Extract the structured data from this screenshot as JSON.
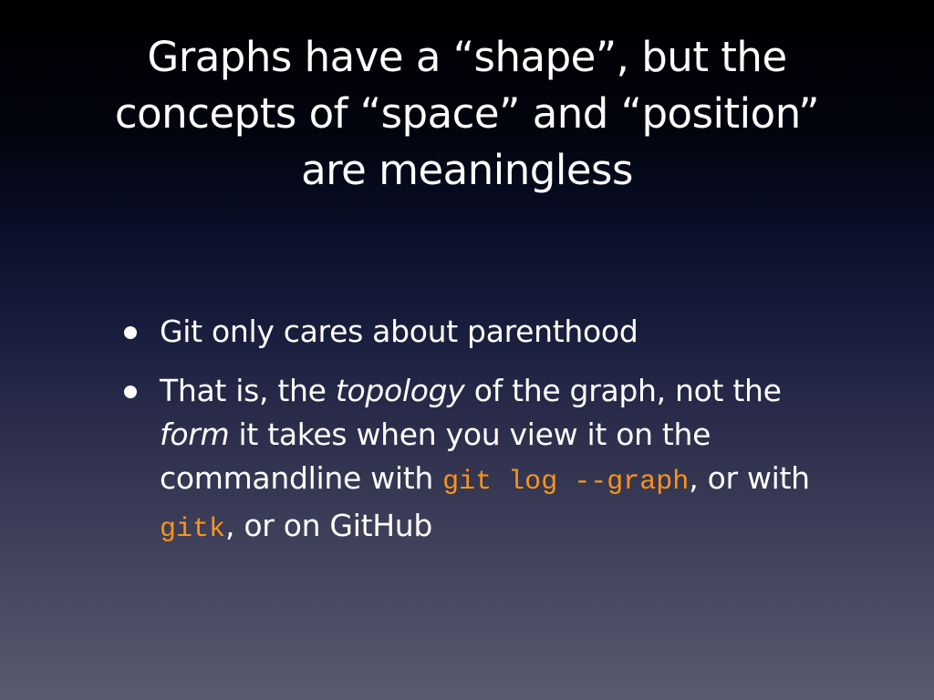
{
  "slide": {
    "title_lines": [
      "Graphs have a “shape”, but the",
      "concepts of “space” and “position”",
      "are meaningless"
    ],
    "bullet1": {
      "text": "Git only cares about parenthood"
    },
    "bullet2": {
      "t1": "That is, the ",
      "em1": "topology",
      "t2": " of the graph, not the ",
      "em2": "form",
      "t3": " it takes when you view it on the commandline with ",
      "code1": "git log --graph",
      "t4": ", or with ",
      "code2": "gitk",
      "t5": ", or on GitHub"
    }
  },
  "colors": {
    "text": "#ffffff",
    "code": "#f7941d"
  }
}
